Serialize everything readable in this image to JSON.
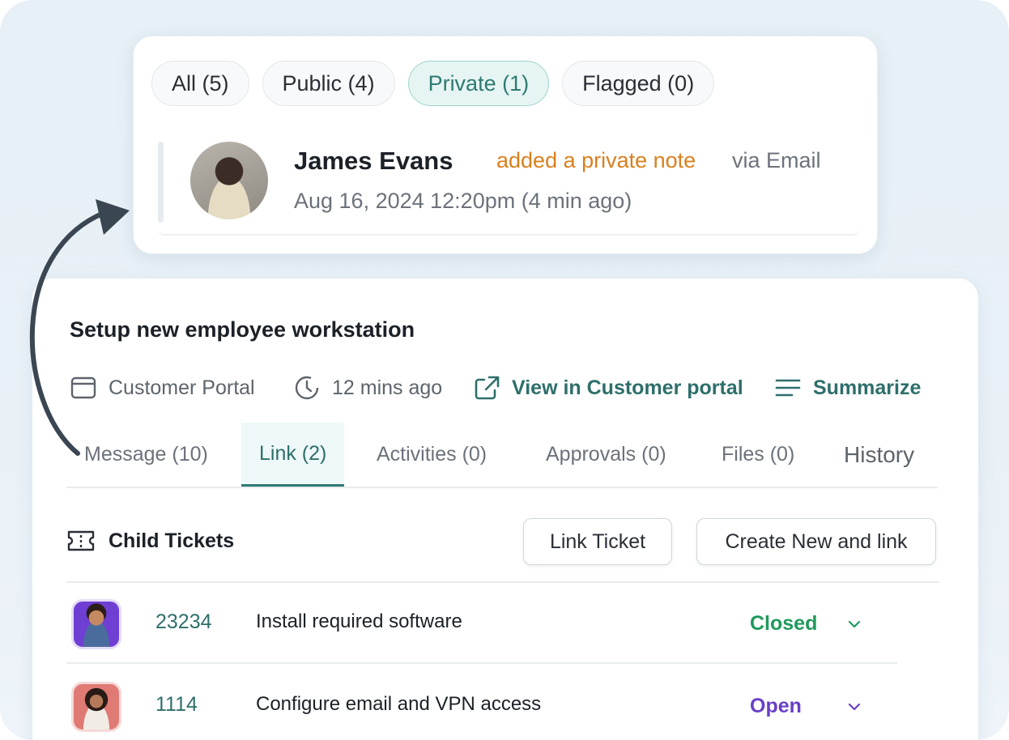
{
  "filters": [
    {
      "label": "All (5)"
    },
    {
      "label": "Public (4)"
    },
    {
      "label": "Private (1)"
    },
    {
      "label": "Flagged (0)"
    }
  ],
  "note": {
    "author": "James Evans",
    "action": "added a private note",
    "via": "via Email",
    "timestamp": "Aug 16, 2024 12:20pm (4 min ago)"
  },
  "ticket": {
    "title": "Setup new employee workstation",
    "source": "Customer Portal",
    "age": "12 mins ago",
    "view_link": "View in Customer portal",
    "summarize": "Summarize"
  },
  "tabs": [
    {
      "label": "Message (10)"
    },
    {
      "label": "Link (2)"
    },
    {
      "label": "Activities (0)"
    },
    {
      "label": "Approvals (0)"
    },
    {
      "label": "Files (0)"
    },
    {
      "label": "History"
    }
  ],
  "child_tickets": {
    "heading": "Child Tickets",
    "link_button": "Link Ticket",
    "create_button": "Create New and link",
    "rows": [
      {
        "id": "23234",
        "subject": "Install required software",
        "status": "Closed",
        "status_color": "#1f9a5b"
      },
      {
        "id": "1114",
        "subject": "Configure email and VPN access",
        "status": "Open",
        "status_color": "#6a3fc9"
      }
    ]
  },
  "colors": {
    "accent": "#2e6f6a",
    "note_action": "#d9801e"
  }
}
